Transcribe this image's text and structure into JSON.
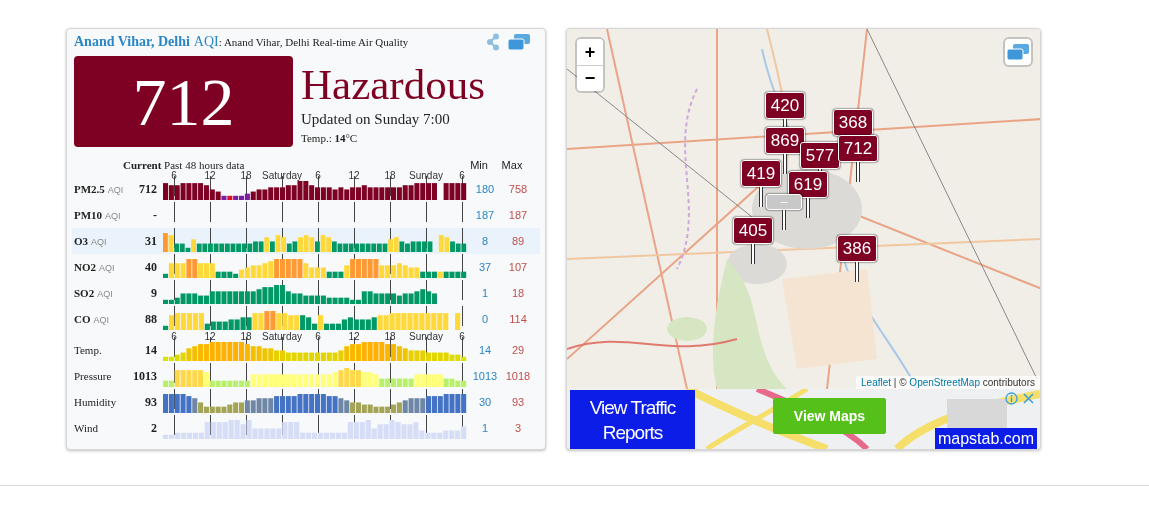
{
  "station": {
    "name": "Anand Vihar, Delhi",
    "aqi_label": "AQI",
    "subtitle": ": Anand Vihar, Delhi Real-time Air Quality"
  },
  "aqi": {
    "value": "712",
    "status": "Hazardous",
    "updated": "Updated on Sunday 7:00",
    "temperature": "Temp.: **14**°C"
  },
  "table": {
    "header": "**Current** Past 48 hours data",
    "min_label": "Min",
    "max_label": "Max",
    "rows": [
      {
        "kind": "axis",
        "labels": [
          "6",
          "12",
          "18",
          "Saturday",
          "6",
          "12",
          "18",
          "Sunday",
          "6"
        ]
      },
      {
        "kind": "pollutant",
        "name": "PM2.5",
        "unit": "AQI",
        "current": "712",
        "min": "180",
        "max": "758",
        "highlighted": false
      },
      {
        "kind": "pollutant",
        "name": "PM10",
        "unit": "AQI",
        "current": "-",
        "min": "187",
        "max": "187",
        "highlighted": false
      },
      {
        "kind": "pollutant",
        "name": "O3",
        "unit": "AQI",
        "current": "31",
        "min": "8",
        "max": "89",
        "highlighted": true
      },
      {
        "kind": "pollutant",
        "name": "NO2",
        "unit": "AQI",
        "current": "40",
        "min": "37",
        "max": "107",
        "highlighted": false
      },
      {
        "kind": "pollutant",
        "name": "SO2",
        "unit": "AQI",
        "current": "9",
        "min": "1",
        "max": "18",
        "highlighted": false
      },
      {
        "kind": "pollutant",
        "name": "CO",
        "unit": "AQI",
        "current": "88",
        "min": "0",
        "max": "114",
        "highlighted": false
      },
      {
        "kind": "axis",
        "labels": [
          "6",
          "12",
          "18",
          "Saturday",
          "6",
          "12",
          "18",
          "Sunday",
          "6"
        ]
      },
      {
        "kind": "weather",
        "name": "Temp.",
        "current": "14",
        "min": "14",
        "max": "29",
        "highlighted": false
      },
      {
        "kind": "weather",
        "name": "Pressure",
        "current": "1013",
        "min": "1013",
        "max": "1018",
        "highlighted": false
      },
      {
        "kind": "weather",
        "name": "Humidity",
        "current": "93",
        "min": "30",
        "max": "93",
        "highlighted": false
      },
      {
        "kind": "weather",
        "name": "Wind",
        "current": "2",
        "min": "1",
        "max": "3",
        "highlighted": false
      }
    ]
  },
  "map": {
    "zoom_in": "+",
    "zoom_out": "−",
    "markers": [
      {
        "value": "420",
        "color": "#7e0023"
      },
      {
        "value": "368",
        "color": "#7e0023"
      },
      {
        "value": "869",
        "color": "#7e0023"
      },
      {
        "value": "577",
        "color": "#7e0023"
      },
      {
        "value": "712",
        "color": "#7e0023"
      },
      {
        "value": "419",
        "color": "#7e0023"
      },
      {
        "value": "619",
        "color": "#7e0023"
      },
      {
        "value": "–",
        "color": "#c8c8c8"
      },
      {
        "value": "405",
        "color": "#7e0023"
      },
      {
        "value": "386",
        "color": "#7e0023"
      }
    ],
    "attribution": {
      "leaflet": "Leaflet",
      "separator": "| ©",
      "osm": "OpenStreetMap",
      "suffix": "contributors"
    }
  },
  "ad": {
    "headline": "View Traffic Reports",
    "button": "View Maps",
    "brand": "mapstab.com"
  }
}
